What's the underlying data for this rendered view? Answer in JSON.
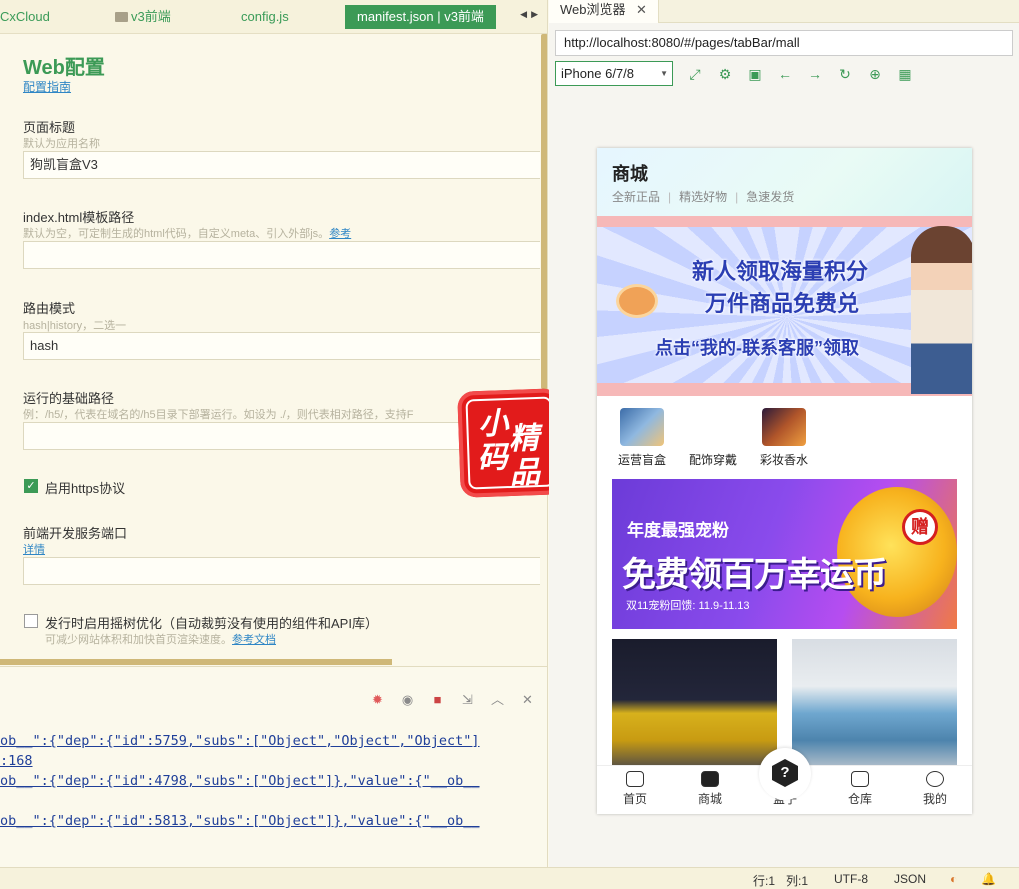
{
  "editor_tabs": [
    {
      "label": "CxCloud"
    },
    {
      "label": "v3前端"
    },
    {
      "label": "config.js"
    },
    {
      "label": "manifest.json | v3前端"
    }
  ],
  "form": {
    "title": "Web配置",
    "guide_link": "配置指南",
    "page_title": {
      "label": "页面标题",
      "hint": "默认为应用名称",
      "value": "狗凯盲盒V3"
    },
    "index_template": {
      "label": "index.html模板路径",
      "hint": "默认为空，可定制生成的html代码，自定义meta、引入外部js。",
      "hint_link": "参考",
      "value": ""
    },
    "router_mode": {
      "label": "路由模式",
      "hint": "hash|history，二选一",
      "value": "hash"
    },
    "base_path": {
      "label": "运行的基础路径",
      "hint": "例：/h5/，代表在域名的/h5目录下部署运行。如设为 ./，则代表相对路径，支持F",
      "value": ""
    },
    "https": {
      "label": "启用https协议",
      "checked": true
    },
    "dev_port": {
      "label": "前端开发服务端口",
      "link": "详情",
      "value": ""
    },
    "tree_shaking": {
      "label": "发行时启用摇树优化（自动裁剪没有使用的组件和API库）",
      "hint": "可减少网站体积和加快首页渲染速度。",
      "hint_link": "参考文档",
      "checked": false
    }
  },
  "stamp": {
    "chars": [
      "小",
      "精",
      "码",
      "品"
    ]
  },
  "console": {
    "tools": [
      "bug-icon",
      "record-icon",
      "stop-icon",
      "export-icon",
      "collapse-icon",
      "clear-icon"
    ],
    "lines": [
      "ob__\":{\"dep\":{\"id\":5759,\"subs\":[\"Object\",\"Object\",\"Object\"]",
      ":168",
      "ob__\":{\"dep\":{\"id\":4798,\"subs\":[\"Object\"]},\"value\":{\"__ob__",
      "ob__\":{\"dep\":{\"id\":5813,\"subs\":[\"Object\"]},\"value\":{\"__ob__"
    ]
  },
  "browser": {
    "tab_label": "Web浏览器",
    "url": "http://localhost:8080/#/pages/tabBar/mall",
    "device": "iPhone 6/7/8",
    "tools": [
      "rotate-icon",
      "settings-icon",
      "console-icon",
      "back-icon",
      "forward-icon",
      "refresh-icon",
      "lock-icon",
      "qr-icon"
    ]
  },
  "phone": {
    "title": "商城",
    "tags": [
      "全新正品",
      "精选好物",
      "急速发货"
    ],
    "banner": {
      "line1": "新人领取海量积分",
      "line2": "万件商品免费兑",
      "line3": "点击“我的-联系客服”领取"
    },
    "categories": [
      {
        "label": "运营盲盒",
        "color": "#4a7fb8"
      },
      {
        "label": "配饰穿戴",
        "color": "#ffffff"
      },
      {
        "label": "彩妆香水",
        "color": "#c56a2a"
      }
    ],
    "promo": {
      "line1": "年度最强宠粉",
      "line2": "免费领百万幸运币",
      "line3": "双11宠粉回馈: 11.9-11.13",
      "gift": "赠"
    },
    "tabbar": [
      {
        "label": "首页"
      },
      {
        "label": "商城"
      },
      {
        "label": "盒子"
      },
      {
        "label": "仓库"
      },
      {
        "label": "我的"
      }
    ],
    "box_glyph": "?"
  },
  "status": {
    "line": "行:1",
    "col": "列:1",
    "encoding": "UTF-8",
    "lang": "JSON"
  },
  "colors": {
    "accent": "#3c9a56",
    "link": "#2f86c5",
    "stamp": "#e21b1b"
  }
}
